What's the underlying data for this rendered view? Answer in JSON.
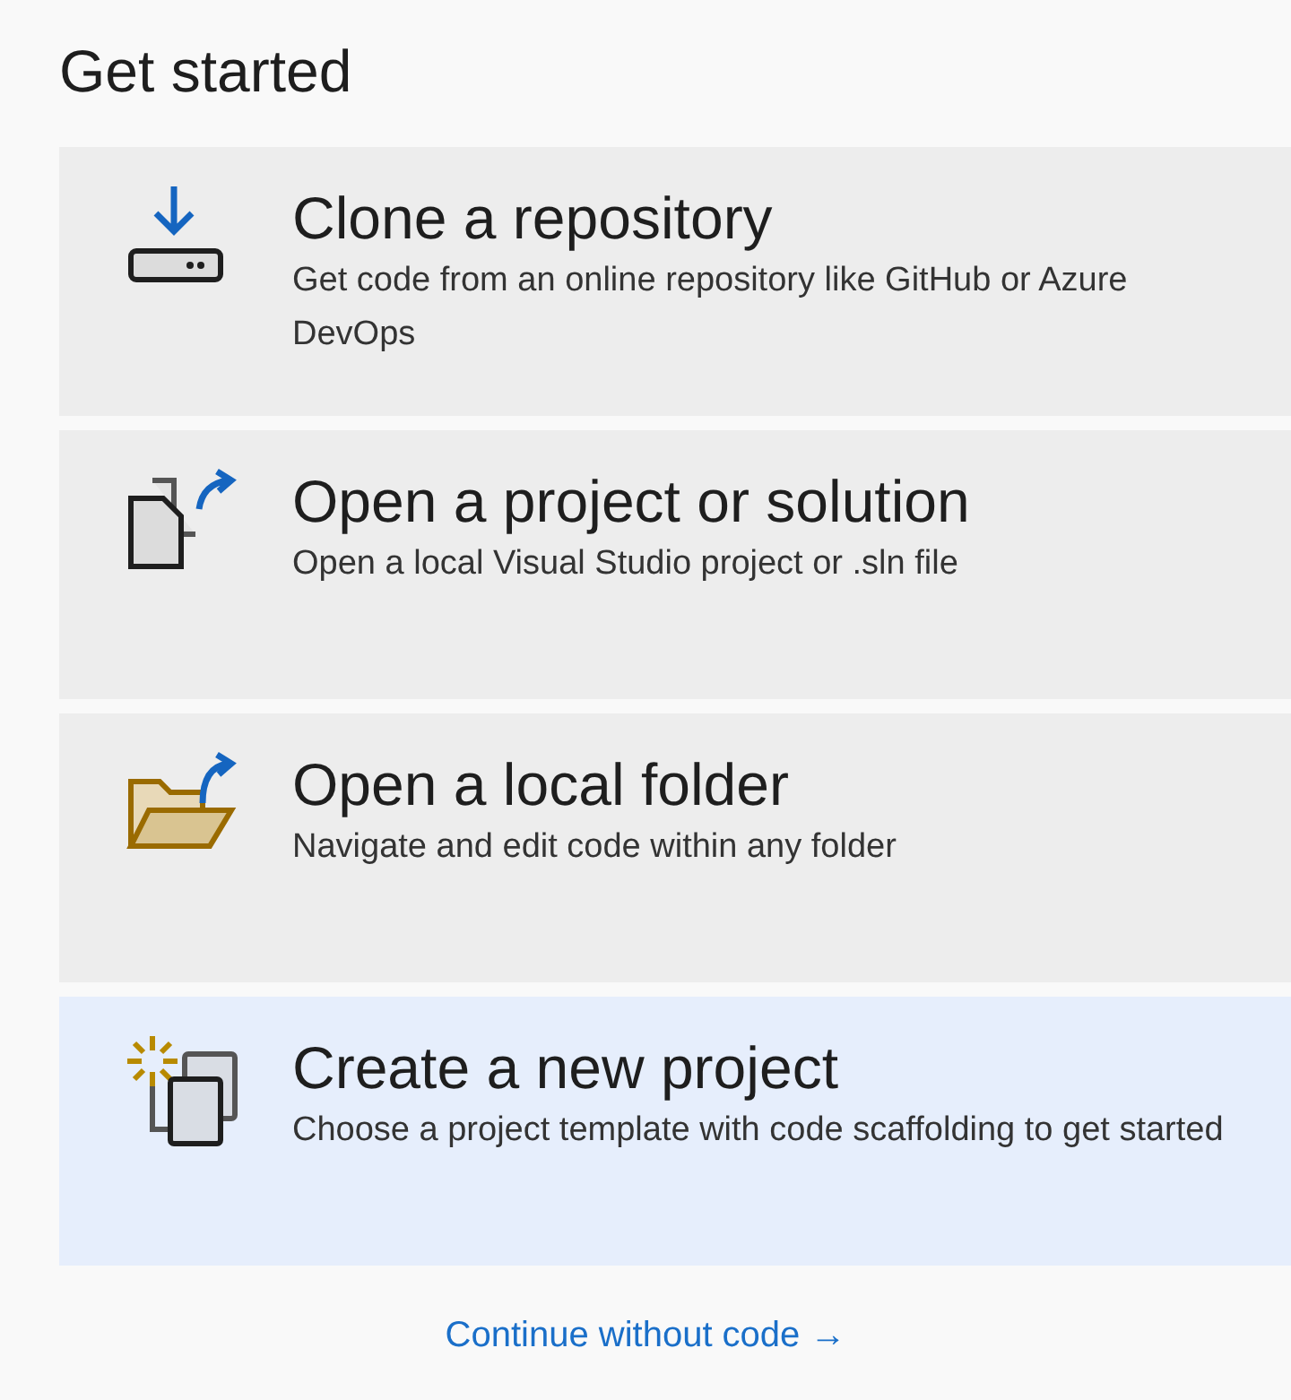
{
  "heading": "Get started",
  "cards": [
    {
      "kind": "clone",
      "title": "Clone a repository",
      "description": "Get code from an online repository like GitHub or Azure DevOps",
      "selected": false
    },
    {
      "kind": "project",
      "title": "Open a project or solution",
      "description": "Open a local Visual Studio project or .sln file",
      "selected": false
    },
    {
      "kind": "folder",
      "title": "Open a local folder",
      "description": "Navigate and edit code within any folder",
      "selected": false
    },
    {
      "kind": "new",
      "title": "Create a new project",
      "description": "Choose a project template with code scaffolding to get started",
      "selected": true
    }
  ],
  "link": "Continue without code →"
}
